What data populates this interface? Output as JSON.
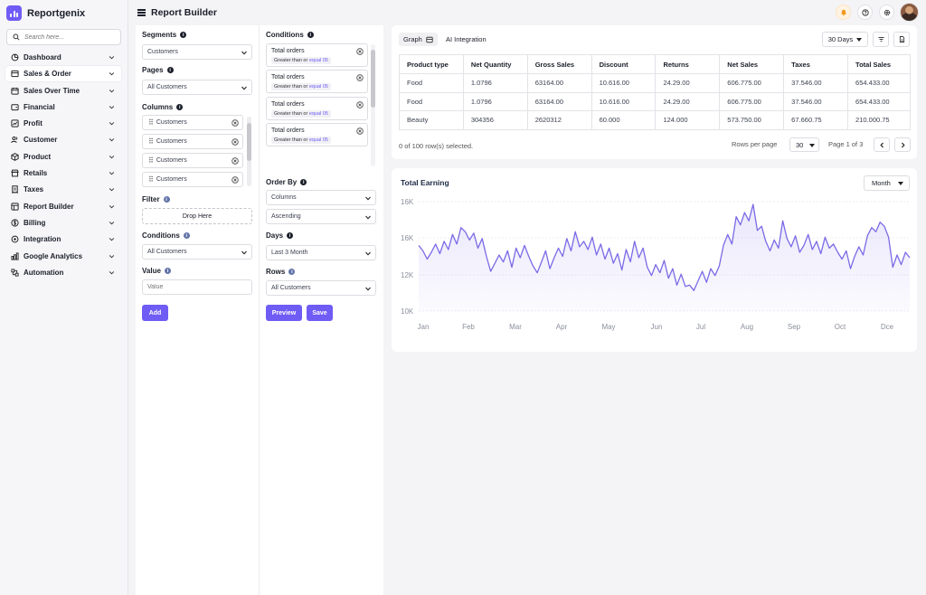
{
  "app": {
    "name": "Reportgenix"
  },
  "search": {
    "placeholder": "Search here..."
  },
  "sidebar": {
    "items": [
      {
        "label": "Dashboard",
        "icon": "dashboard-icon"
      },
      {
        "label": "Sales & Order",
        "icon": "sales-icon"
      },
      {
        "label": "Sales Over Time",
        "icon": "calendar-icon"
      },
      {
        "label": "Financial",
        "icon": "wallet-icon"
      },
      {
        "label": "Profit",
        "icon": "chart-icon"
      },
      {
        "label": "Customer",
        "icon": "users-icon"
      },
      {
        "label": "Product",
        "icon": "box-icon"
      },
      {
        "label": "Retails",
        "icon": "store-icon"
      },
      {
        "label": "Taxes",
        "icon": "receipt-icon"
      },
      {
        "label": "Report Builder",
        "icon": "report-icon"
      },
      {
        "label": "Billing",
        "icon": "dollar-icon"
      },
      {
        "label": "Integration",
        "icon": "plug-icon"
      },
      {
        "label": "Google Analytics",
        "icon": "analytics-icon"
      },
      {
        "label": "Automation",
        "icon": "automation-icon"
      }
    ]
  },
  "header": {
    "title": "Report Builder"
  },
  "builder": {
    "segments": {
      "label": "Segments",
      "value": "Customers"
    },
    "pages": {
      "label": "Pages",
      "value": "All Customers"
    },
    "columns": {
      "label": "Columns",
      "items": [
        "Customers",
        "Customers",
        "Customers",
        "Customers"
      ]
    },
    "filter": {
      "label": "Filter",
      "drop": "Drop Here"
    },
    "conditions_left": {
      "label": "Conditions",
      "value": "All Customers"
    },
    "value": {
      "label": "Value",
      "placeholder": "Value"
    },
    "add_label": "Add",
    "conditions": {
      "label": "Conditions",
      "items": [
        {
          "title": "Total orders",
          "rule": "Greater than or",
          "value": "equal 05"
        },
        {
          "title": "Total orders",
          "rule": "Greater than or",
          "value": "equal 05"
        },
        {
          "title": "Total orders",
          "rule": "Greater than or",
          "value": "equal 05"
        },
        {
          "title": "Total orders",
          "rule": "Greater than or",
          "value": "equal 05"
        }
      ]
    },
    "order_by": {
      "label": "Order By",
      "column": "Columns",
      "direction": "Ascending"
    },
    "days": {
      "label": "Days",
      "value": "Last 3 Month"
    },
    "rows": {
      "label": "Rows",
      "value": "All Customers"
    },
    "preview_label": "Preview",
    "save_label": "Save"
  },
  "results": {
    "tabs": [
      "Graph",
      "AI Integration"
    ],
    "range": "30 Days",
    "columns": [
      "Product type",
      "Net Quantity",
      "Gross Sales",
      "Discount",
      "Returns",
      "Net Sales",
      "Taxes",
      "Total Sales"
    ],
    "rows": [
      [
        "Food",
        "1.0796",
        "63164.00",
        "10.616.00",
        "24.29.00",
        "606.775.00",
        "37.546.00",
        "654.433.00"
      ],
      [
        "Food",
        "1.0796",
        "63164.00",
        "10.616.00",
        "24.29.00",
        "606.775.00",
        "37.546.00",
        "654.433.00"
      ],
      [
        "Beauty",
        "304356",
        "2620312",
        "60.000",
        "124.000",
        "573.750.00",
        "67.660.75",
        "210.000.75"
      ]
    ],
    "selected_text": "0 of 100 row(s) selected.",
    "rows_per_page_label": "Rows per page",
    "rows_per_page": "30",
    "page_text": "Page 1 of 3"
  },
  "chart": {
    "title": "Total Earning",
    "period": "Month",
    "line_color": "#7a6ae6"
  },
  "chart_data": {
    "type": "area",
    "title": "Total Earning",
    "categories": [
      "Jan",
      "Feb",
      "Mar",
      "Apr",
      "May",
      "Jun",
      "Jul",
      "Aug",
      "Sep",
      "Oct",
      "Dce"
    ],
    "ytick_labels": [
      "16K",
      "16K",
      "12K",
      "10K"
    ],
    "grid": true,
    "series": [
      {
        "values": [
          14.8,
          14.4,
          13.8,
          14.3,
          14.9,
          14.2,
          15.1,
          14.5,
          15.6,
          14.9,
          16.1,
          15.8,
          15.2,
          15.7,
          14.6,
          15.3,
          14.0,
          12.9,
          13.5,
          14.1,
          13.6,
          14.4,
          13.2,
          14.6,
          13.9,
          14.8,
          14.0,
          13.3,
          12.8,
          13.6,
          14.4,
          13.1,
          13.9,
          14.6,
          14.0,
          15.3,
          14.4,
          15.8,
          14.7,
          15.1,
          14.5,
          15.4,
          14.1,
          14.9,
          13.8,
          14.6,
          13.5,
          14.2,
          13.0,
          14.5,
          13.6,
          15.1,
          13.9,
          14.6,
          13.2,
          12.6,
          13.4,
          12.8,
          13.7,
          12.4,
          13.1,
          11.9,
          12.7,
          11.8,
          11.9,
          11.5,
          12.2,
          12.9,
          12.1,
          13.1,
          12.6,
          13.3,
          14.8,
          15.6,
          14.9,
          16.9,
          16.3,
          17.2,
          16.6,
          17.8,
          15.9,
          16.2,
          15.1,
          14.4,
          15.2,
          14.6,
          16.6,
          15.3,
          14.7,
          15.5,
          14.3,
          14.8,
          15.6,
          14.5,
          15.1,
          14.2,
          15.4,
          14.6,
          14.9,
          14.3,
          13.8,
          14.4,
          13.1,
          14.0,
          14.7,
          14.1,
          15.5,
          16.1,
          15.8,
          16.5,
          16.2,
          15.4,
          13.2,
          14.1,
          13.4,
          14.3,
          13.9
        ]
      }
    ],
    "yrange_raw": [
      10,
      18
    ],
    "color": "#7a6ae6"
  }
}
